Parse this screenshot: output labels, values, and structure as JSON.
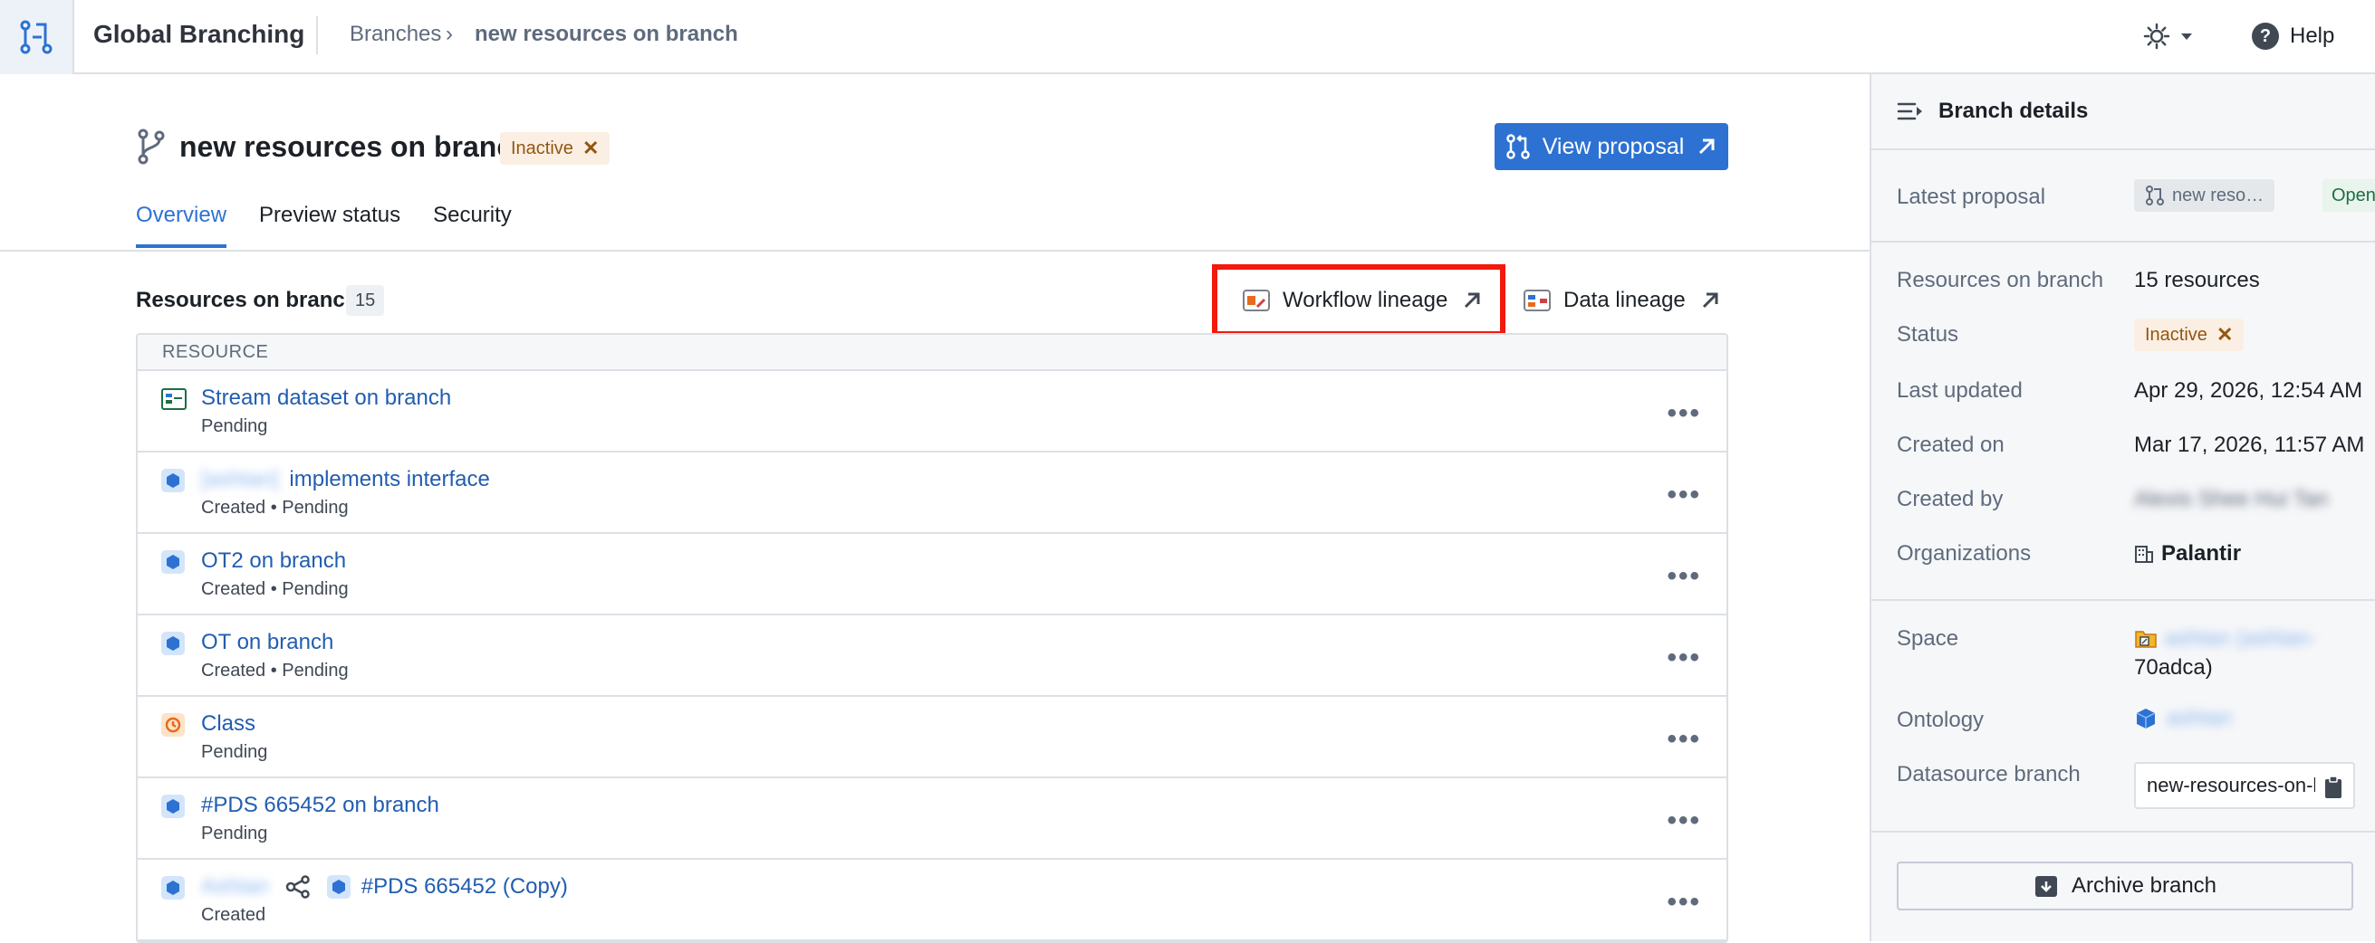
{
  "app": {
    "title": "Global Branching",
    "icon": "branching-app-icon"
  },
  "breadcrumb": {
    "parent": "Branches",
    "separator": "›",
    "current": "new resources on branch"
  },
  "header_right": {
    "theme_icon": "sun-icon",
    "help_label": "Help",
    "help_glyph": "?"
  },
  "branch": {
    "title": "new resources on branch",
    "status": "Inactive",
    "view_proposal_label": "View proposal"
  },
  "tabs": [
    {
      "label": "Overview",
      "active": true
    },
    {
      "label": "Preview status",
      "active": false
    },
    {
      "label": "Security",
      "active": false
    }
  ],
  "resources": {
    "title": "Resources on branch",
    "count": "15",
    "workflow_lineage_label": "Workflow lineage",
    "data_lineage_label": "Data lineage",
    "column_header": "RESOURCE",
    "rows": [
      {
        "icon": "stream-dataset-icon",
        "name": "Stream dataset on branch",
        "status": "Pending"
      },
      {
        "icon": "object-type-icon",
        "name_prefix": "[ashtan]",
        "name": "implements interface",
        "status": "Created  •  Pending"
      },
      {
        "icon": "object-type-icon",
        "name": "OT2 on branch",
        "status": "Created  •  Pending"
      },
      {
        "icon": "object-type-icon",
        "name": "OT on branch",
        "status": "Created  •  Pending"
      },
      {
        "icon": "class-icon",
        "name": "Class",
        "status": "Pending"
      },
      {
        "icon": "object-type-icon",
        "name": "#PDS 665452 on branch",
        "status": "Pending"
      },
      {
        "icon": "object-type-icon",
        "name_prefix": "Ashtan",
        "name": "#PDS 665452 (Copy)",
        "status": "Created"
      }
    ],
    "more_glyph": "•••"
  },
  "side": {
    "title": "Branch details",
    "latest_proposal_label": "Latest proposal",
    "latest_proposal_value": "new reso…",
    "latest_proposal_state": "Open",
    "resources_label": "Resources on branch",
    "resources_value": "15 resources",
    "status_label": "Status",
    "status_value": "Inactive",
    "last_updated_label": "Last updated",
    "last_updated_value": "Apr 29, 2026, 12:54 AM",
    "created_on_label": "Created on",
    "created_on_value": "Mar 17, 2026, 11:57 AM",
    "created_by_label": "Created by",
    "created_by_value": "Alexis Shee Hui Tan",
    "organizations_label": "Organizations",
    "organizations_value": "Palantir",
    "space_label": "Space",
    "space_value_blur": "ashtan (ashtan-",
    "space_value_tail": "70adca)",
    "ontology_label": "Ontology",
    "ontology_value": "ashtan",
    "datasource_label": "Datasource branch",
    "datasource_value": "new-resources-on-branch",
    "archive_label": "Archive branch"
  },
  "colors": {
    "accent": "#2d72d2",
    "highlight": "#f3190c",
    "inactive_bg": "#fbefe4"
  }
}
